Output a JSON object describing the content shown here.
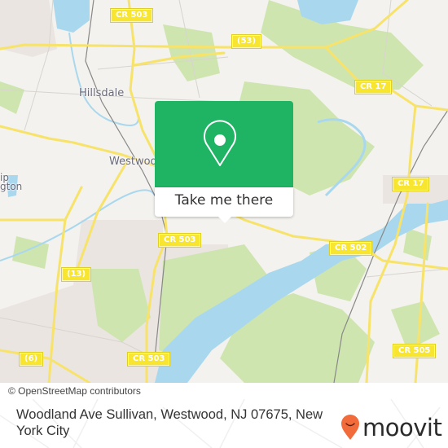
{
  "map": {
    "place_labels": [
      {
        "id": "hillsdale",
        "text": "Hillsdale"
      },
      {
        "id": "westwood",
        "text": "Westwood"
      },
      {
        "id": "township-washington",
        "text": "ip\ngton"
      }
    ],
    "road_shields": [
      {
        "id": "cr503-top",
        "text": "CR 503"
      },
      {
        "id": "rt53",
        "text": "(53)"
      },
      {
        "id": "cr17-upper",
        "text": "CR 17"
      },
      {
        "id": "cr17-lower",
        "text": "CR 17"
      },
      {
        "id": "cr503-mid",
        "text": "CR 503"
      },
      {
        "id": "rt13",
        "text": "(13)"
      },
      {
        "id": "cr502",
        "text": "CR 502"
      },
      {
        "id": "rt6",
        "text": "(6)"
      },
      {
        "id": "cr503-bottom",
        "text": "CR 503"
      },
      {
        "id": "cr505",
        "text": "CR 505"
      }
    ],
    "colors": {
      "land": "#f3f2ee",
      "park": "#cfe5b0",
      "water": "#a9d8ee",
      "road": "#f7e36a",
      "urban": "#ebe5e2"
    }
  },
  "popup": {
    "icon": "map-pin-icon",
    "button_label": "Take me there",
    "accent_color": "#1eb464"
  },
  "attribution": "© OpenStreetMap contributors",
  "footer": {
    "address": "Woodland Ave Sullivan, Westwood, NJ 07675, New York City",
    "brand": "moovit",
    "brand_color": "#f26b3a"
  }
}
